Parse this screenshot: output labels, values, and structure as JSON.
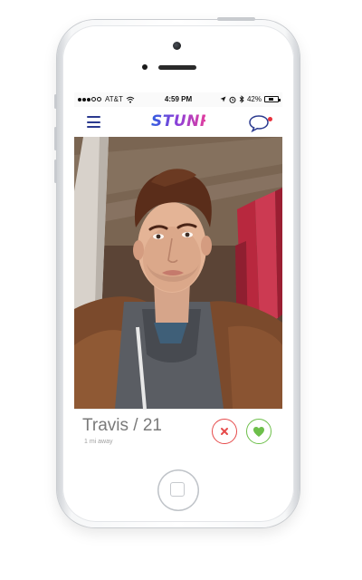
{
  "status_bar": {
    "carrier": "AT&T",
    "time": "4:59 PM",
    "battery_percent_text": "42%",
    "battery_level": 0.42
  },
  "nav": {
    "logo_text": "STUNR",
    "accent_color": "#2b3a8f",
    "notification_color": "#e8323c",
    "icons": [
      "menu-icon",
      "chat-icon"
    ]
  },
  "profile": {
    "name_age": "Travis / 21",
    "distance": "1 mi away"
  },
  "actions": {
    "nope_icon": "close-icon",
    "nope_color": "#e64b4b",
    "like_icon": "heart-icon",
    "like_color": "#6dbf4a"
  }
}
